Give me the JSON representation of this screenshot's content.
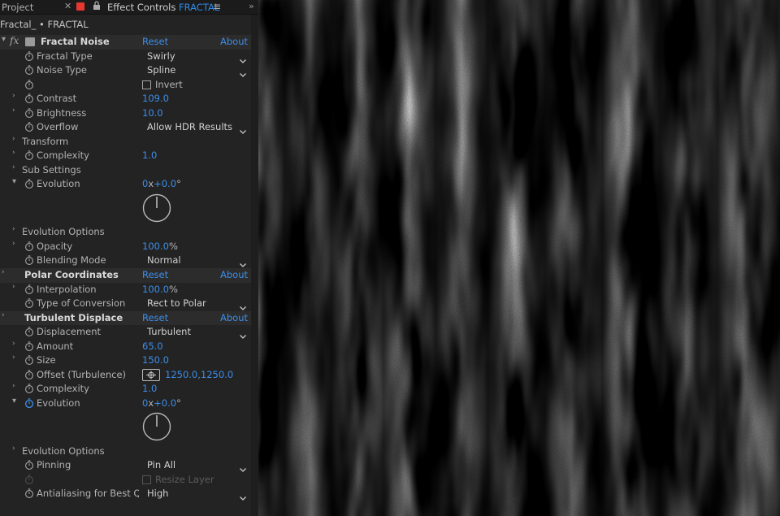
{
  "tabs": {
    "project": "Project",
    "effect_controls_prefix": "Effect Controls",
    "effect_controls_comp": "FRACTAL"
  },
  "layer_path": "Fractal_ • FRACTAL",
  "effects": {
    "fractal_noise": {
      "name": "Fractal Noise",
      "reset": "Reset",
      "about": "About",
      "fractal_type": {
        "label": "Fractal Type",
        "value": "Swirly"
      },
      "noise_type": {
        "label": "Noise Type",
        "value": "Spline"
      },
      "invert": {
        "label": "Invert",
        "checked": false
      },
      "contrast": {
        "label": "Contrast",
        "value": "109.0"
      },
      "brightness": {
        "label": "Brightness",
        "value": "10.0"
      },
      "overflow": {
        "label": "Overflow",
        "value": "Allow HDR Results"
      },
      "transform": {
        "label": "Transform"
      },
      "complexity": {
        "label": "Complexity",
        "value": "1.0"
      },
      "sub_settings": {
        "label": "Sub Settings"
      },
      "evolution": {
        "label": "Evolution",
        "rev": "0",
        "sep": "x",
        "deg": "+0.0",
        "unit": "°"
      },
      "evolution_options": {
        "label": "Evolution Options"
      },
      "opacity": {
        "label": "Opacity",
        "value": "100.0",
        "unit": "%"
      },
      "blending_mode": {
        "label": "Blending Mode",
        "value": "Normal"
      }
    },
    "polar_coordinates": {
      "name": "Polar Coordinates",
      "reset": "Reset",
      "about": "About",
      "interpolation": {
        "label": "Interpolation",
        "value": "100.0",
        "unit": "%"
      },
      "type_of_conversion": {
        "label": "Type of Conversion",
        "value": "Rect to Polar"
      }
    },
    "turbulent_displace": {
      "name": "Turbulent Displace",
      "reset": "Reset",
      "about": "About",
      "displacement": {
        "label": "Displacement",
        "value": "Turbulent"
      },
      "amount": {
        "label": "Amount",
        "value": "65.0"
      },
      "size": {
        "label": "Size",
        "value": "150.0"
      },
      "offset": {
        "label": "Offset (Turbulence)",
        "value": "1250.0,1250.0"
      },
      "complexity": {
        "label": "Complexity",
        "value": "1.0"
      },
      "evolution": {
        "label": "Evolution",
        "rev": "0",
        "sep": "x",
        "deg": "+0.0",
        "unit": "°"
      },
      "evolution_options": {
        "label": "Evolution Options"
      },
      "pinning": {
        "label": "Pinning",
        "value": "Pin All"
      },
      "resize_layer": {
        "label": "Resize Layer",
        "checked": false
      },
      "antialiasing": {
        "label": "Antialiasing for Best Qua",
        "value": "High"
      }
    }
  },
  "colors": {
    "accent_blue": "#3c8de8",
    "label_swatch_red": "#e8372f",
    "panel_bg": "#232323"
  }
}
